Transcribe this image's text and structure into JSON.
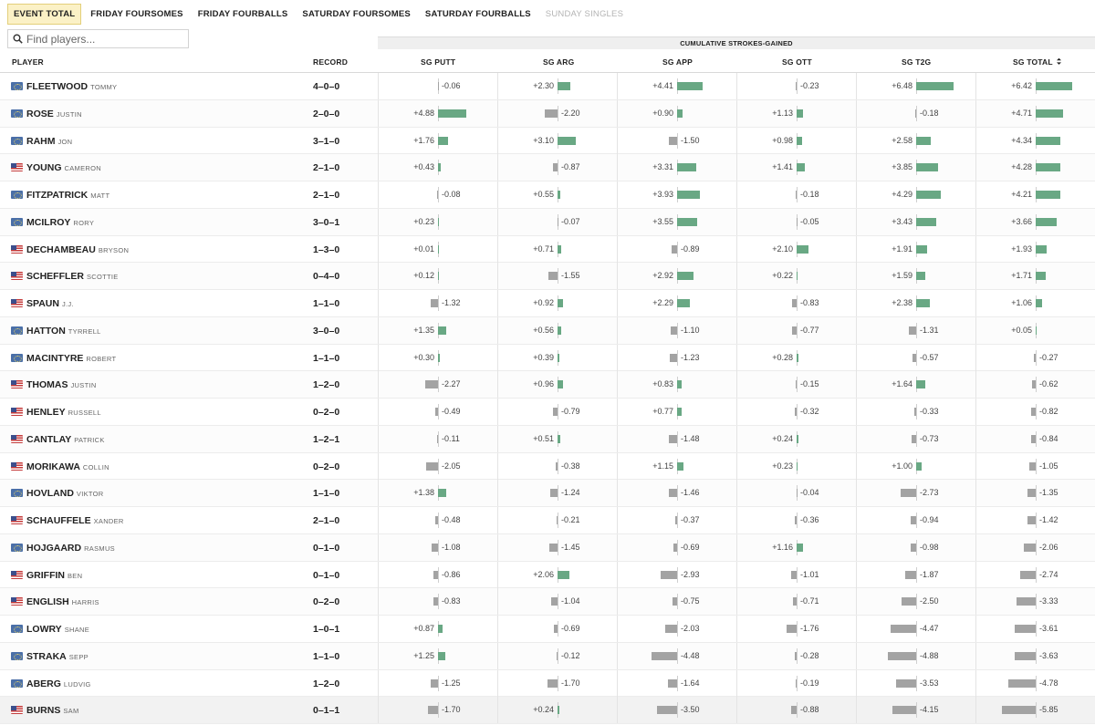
{
  "tabs": [
    {
      "label": "EVENT TOTAL",
      "state": "active"
    },
    {
      "label": "FRIDAY FOURSOMES",
      "state": "normal"
    },
    {
      "label": "FRIDAY FOURBALLS",
      "state": "normal"
    },
    {
      "label": "SATURDAY FOURSOMES",
      "state": "normal"
    },
    {
      "label": "SATURDAY FOURBALLS",
      "state": "normal"
    },
    {
      "label": "SUNDAY SINGLES",
      "state": "disabled"
    }
  ],
  "search": {
    "placeholder": "Find players...",
    "value": "",
    "icon": "search-icon"
  },
  "table": {
    "group_header": "CUMULATIVE STROKES-GAINED",
    "headers": {
      "player": "PLAYER",
      "record": "RECORD",
      "sg_putt": "SG PUTT",
      "sg_arg": "SG ARG",
      "sg_app": "SG APP",
      "sg_ott": "SG OTT",
      "sg_t2g": "SG T2G",
      "sg_total": "SG TOTAL"
    },
    "sort": {
      "column": "sg_total",
      "direction": "descending",
      "icon": "sort-icon"
    },
    "colors": {
      "positive": "#69a884",
      "negative": "#a3a3a3"
    },
    "rows": [
      {
        "last": "FLEETWOOD",
        "first": "TOMMY",
        "flag": "eu",
        "record": "4–0–0",
        "sg": [
          "-0.06",
          "+2.30",
          "+4.41",
          "-0.23",
          "+6.48",
          "+6.42"
        ]
      },
      {
        "last": "ROSE",
        "first": "JUSTIN",
        "flag": "eu",
        "record": "2–0–0",
        "sg": [
          "+4.88",
          "-2.20",
          "+0.90",
          "+1.13",
          "-0.18",
          "+4.71"
        ]
      },
      {
        "last": "RAHM",
        "first": "JON",
        "flag": "eu",
        "record": "3–1–0",
        "sg": [
          "+1.76",
          "+3.10",
          "-1.50",
          "+0.98",
          "+2.58",
          "+4.34"
        ]
      },
      {
        "last": "YOUNG",
        "first": "CAMERON",
        "flag": "us",
        "record": "2–1–0",
        "sg": [
          "+0.43",
          "-0.87",
          "+3.31",
          "+1.41",
          "+3.85",
          "+4.28"
        ]
      },
      {
        "last": "FITZPATRICK",
        "first": "MATT",
        "flag": "eu",
        "record": "2–1–0",
        "sg": [
          "-0.08",
          "+0.55",
          "+3.93",
          "-0.18",
          "+4.29",
          "+4.21"
        ]
      },
      {
        "last": "MCILROY",
        "first": "RORY",
        "flag": "eu",
        "record": "3–0–1",
        "sg": [
          "+0.23",
          "-0.07",
          "+3.55",
          "-0.05",
          "+3.43",
          "+3.66"
        ]
      },
      {
        "last": "DECHAMBEAU",
        "first": "BRYSON",
        "flag": "us",
        "record": "1–3–0",
        "sg": [
          "+0.01",
          "+0.71",
          "-0.89",
          "+2.10",
          "+1.91",
          "+1.93"
        ]
      },
      {
        "last": "SCHEFFLER",
        "first": "SCOTTIE",
        "flag": "us",
        "record": "0–4–0",
        "sg": [
          "+0.12",
          "-1.55",
          "+2.92",
          "+0.22",
          "+1.59",
          "+1.71"
        ]
      },
      {
        "last": "SPAUN",
        "first": "J.J.",
        "flag": "us",
        "record": "1–1–0",
        "sg": [
          "-1.32",
          "+0.92",
          "+2.29",
          "-0.83",
          "+2.38",
          "+1.06"
        ]
      },
      {
        "last": "HATTON",
        "first": "TYRRELL",
        "flag": "eu",
        "record": "3–0–0",
        "sg": [
          "+1.35",
          "+0.56",
          "-1.10",
          "-0.77",
          "-1.31",
          "+0.05"
        ]
      },
      {
        "last": "MACINTYRE",
        "first": "ROBERT",
        "flag": "eu",
        "record": "1–1–0",
        "sg": [
          "+0.30",
          "+0.39",
          "-1.23",
          "+0.28",
          "-0.57",
          "-0.27"
        ]
      },
      {
        "last": "THOMAS",
        "first": "JUSTIN",
        "flag": "us",
        "record": "1–2–0",
        "sg": [
          "-2.27",
          "+0.96",
          "+0.83",
          "-0.15",
          "+1.64",
          "-0.62"
        ]
      },
      {
        "last": "HENLEY",
        "first": "RUSSELL",
        "flag": "us",
        "record": "0–2–0",
        "sg": [
          "-0.49",
          "-0.79",
          "+0.77",
          "-0.32",
          "-0.33",
          "-0.82"
        ]
      },
      {
        "last": "CANTLAY",
        "first": "PATRICK",
        "flag": "us",
        "record": "1–2–1",
        "sg": [
          "-0.11",
          "+0.51",
          "-1.48",
          "+0.24",
          "-0.73",
          "-0.84"
        ]
      },
      {
        "last": "MORIKAWA",
        "first": "COLLIN",
        "flag": "us",
        "record": "0–2–0",
        "sg": [
          "-2.05",
          "-0.38",
          "+1.15",
          "+0.23",
          "+1.00",
          "-1.05"
        ]
      },
      {
        "last": "HOVLAND",
        "first": "VIKTOR",
        "flag": "eu",
        "record": "1–1–0",
        "sg": [
          "+1.38",
          "-1.24",
          "-1.46",
          "-0.04",
          "-2.73",
          "-1.35"
        ]
      },
      {
        "last": "SCHAUFFELE",
        "first": "XANDER",
        "flag": "us",
        "record": "2–1–0",
        "sg": [
          "-0.48",
          "-0.21",
          "-0.37",
          "-0.36",
          "-0.94",
          "-1.42"
        ]
      },
      {
        "last": "HOJGAARD",
        "first": "RASMUS",
        "flag": "eu",
        "record": "0–1–0",
        "sg": [
          "-1.08",
          "-1.45",
          "-0.69",
          "+1.16",
          "-0.98",
          "-2.06"
        ]
      },
      {
        "last": "GRIFFIN",
        "first": "BEN",
        "flag": "us",
        "record": "0–1–0",
        "sg": [
          "-0.86",
          "+2.06",
          "-2.93",
          "-1.01",
          "-1.87",
          "-2.74"
        ]
      },
      {
        "last": "ENGLISH",
        "first": "HARRIS",
        "flag": "us",
        "record": "0–2–0",
        "sg": [
          "-0.83",
          "-1.04",
          "-0.75",
          "-0.71",
          "-2.50",
          "-3.33"
        ]
      },
      {
        "last": "LOWRY",
        "first": "SHANE",
        "flag": "eu",
        "record": "1–0–1",
        "sg": [
          "+0.87",
          "-0.69",
          "-2.03",
          "-1.76",
          "-4.47",
          "-3.61"
        ]
      },
      {
        "last": "STRAKA",
        "first": "SEPP",
        "flag": "eu",
        "record": "1–1–0",
        "sg": [
          "+1.25",
          "-0.12",
          "-4.48",
          "-0.28",
          "-4.88",
          "-3.63"
        ]
      },
      {
        "last": "ABERG",
        "first": "LUDVIG",
        "flag": "eu",
        "record": "1–2–0",
        "sg": [
          "-1.25",
          "-1.70",
          "-1.64",
          "-0.19",
          "-3.53",
          "-4.78"
        ]
      },
      {
        "last": "BURNS",
        "first": "SAM",
        "flag": "us",
        "record": "0–1–1",
        "sg": [
          "-1.70",
          "+0.24",
          "-3.50",
          "-0.88",
          "-4.15",
          "-5.85"
        ]
      }
    ]
  }
}
